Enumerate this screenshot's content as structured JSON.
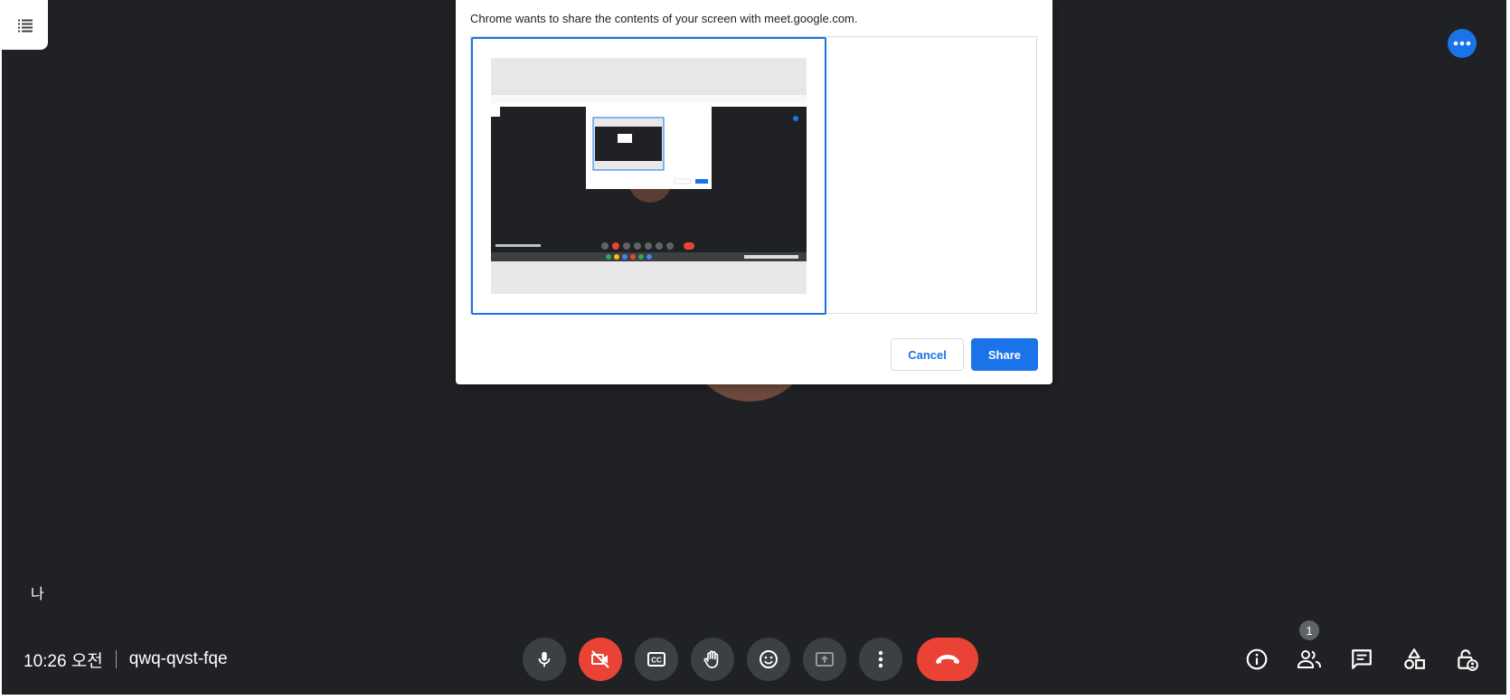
{
  "dialog": {
    "description": "Chrome wants to share the contents of your screen with meet.google.com.",
    "cancel_label": "Cancel",
    "share_label": "Share"
  },
  "meeting": {
    "self_name": "나",
    "time": "10:26 오전",
    "code": "qwq-qvst-fqe",
    "participant_count": "1"
  },
  "icons": {
    "tab": "list-icon",
    "more_blue": "more-horiz-icon",
    "controls": [
      "mic-icon",
      "camera-off-icon",
      "captions-icon",
      "raise-hand-icon",
      "emoji-icon",
      "present-icon",
      "more-vert-icon",
      "call-end-icon"
    ],
    "right": [
      "info-icon",
      "people-icon",
      "chat-icon",
      "activities-icon",
      "host-controls-icon"
    ]
  },
  "colors": {
    "background": "#202124",
    "accent": "#1a73e8",
    "danger": "#ea4335",
    "control_bg": "#3c4043"
  }
}
